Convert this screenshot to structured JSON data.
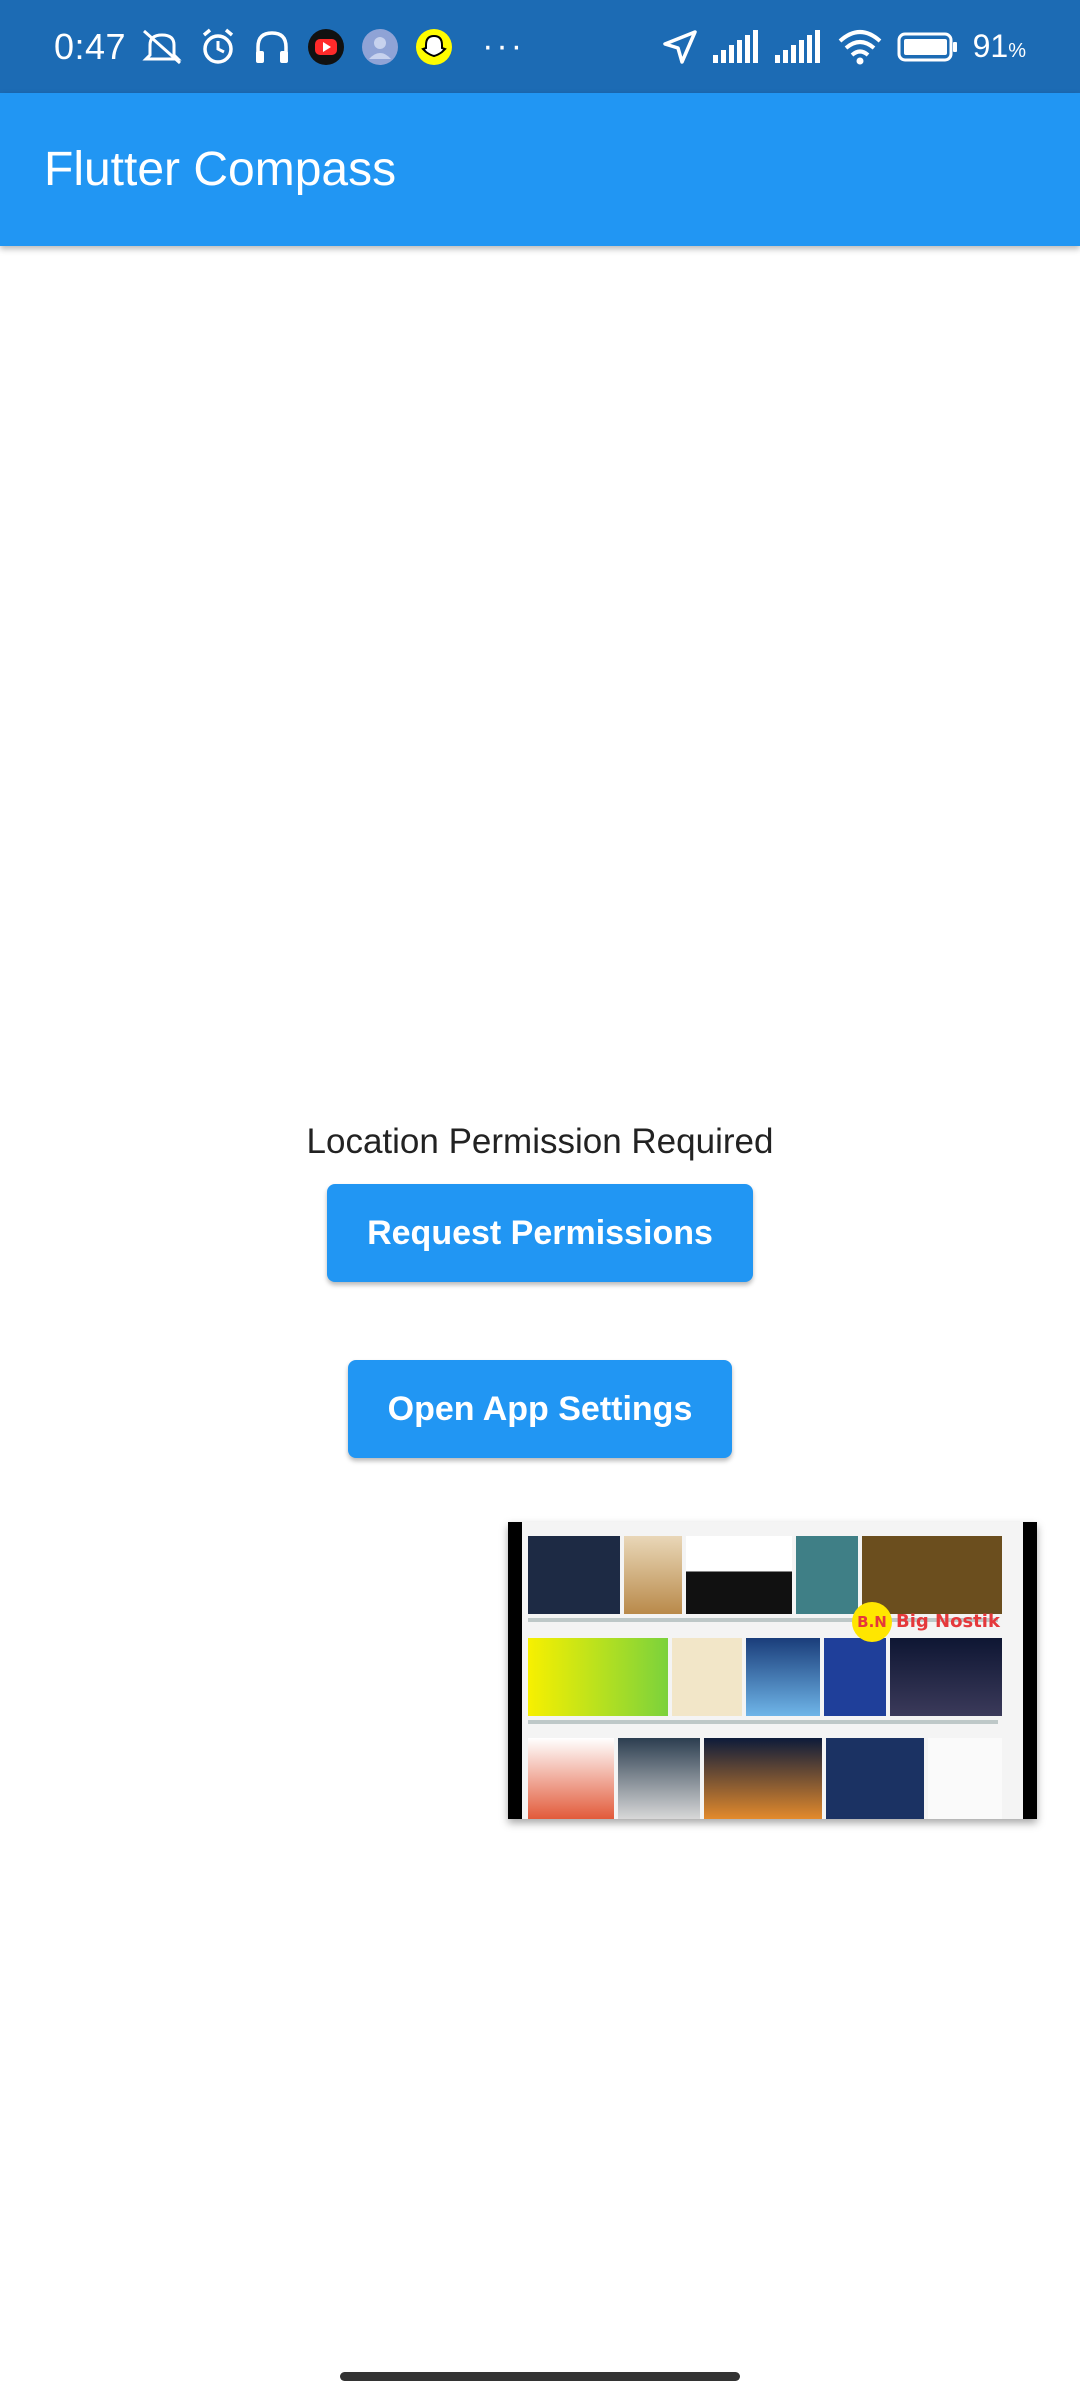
{
  "status_bar": {
    "time": "0:47",
    "battery_percent": "91",
    "battery_unit": "%",
    "icons": [
      "mute-icon",
      "alarm-icon",
      "headset-icon",
      "youtube-icon",
      "avatar-icon",
      "snapchat-icon",
      "more-dots-icon",
      "location-arrow-icon",
      "signal-icon",
      "signal-icon",
      "wifi-icon",
      "battery-icon"
    ],
    "overflow": "···"
  },
  "app_bar": {
    "title": "Flutter Compass"
  },
  "main": {
    "permission_text": "Location Permission Required",
    "request_button": "Request Permissions",
    "settings_button": "Open App Settings"
  },
  "thumbnail": {
    "watermark_badge": "B.N",
    "watermark_text": "Big Nostik"
  },
  "colors": {
    "status_bar": "#1c6bb4",
    "app_bar": "#2196f3",
    "button": "#2196f3"
  }
}
